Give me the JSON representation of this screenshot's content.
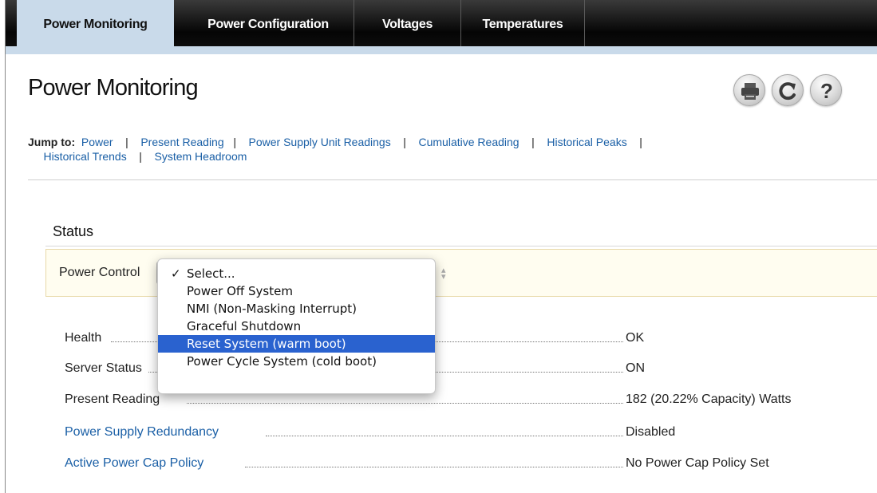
{
  "tabs": [
    {
      "label": "Power Monitoring",
      "active": true
    },
    {
      "label": "Power Configuration",
      "active": false
    },
    {
      "label": "Voltages",
      "active": false
    },
    {
      "label": "Temperatures",
      "active": false
    }
  ],
  "page": {
    "title": "Power Monitoring",
    "toolbar_icons": [
      "print-icon",
      "refresh-icon",
      "help-icon"
    ]
  },
  "jump": {
    "label": "Jump to:",
    "links": [
      "Power",
      "Present Reading",
      "Power Supply Unit Readings",
      "Cumulative Reading",
      "Historical Peaks",
      "Historical Trends",
      "System Headroom"
    ],
    "separator": "|"
  },
  "status": {
    "title": "Status",
    "power_control_label": "Power Control",
    "rows": [
      {
        "label": "Health",
        "value": "OK",
        "is_link": false
      },
      {
        "label": "Server Status",
        "value": "ON",
        "is_link": false
      },
      {
        "label": "Present Reading",
        "value": "182 (20.22% Capacity) Watts",
        "is_link": false
      },
      {
        "label": "Power Supply Redundancy",
        "value": "Disabled",
        "is_link": true
      },
      {
        "label": "Active Power Cap Policy",
        "value": "No Power Cap Policy Set",
        "is_link": true
      }
    ]
  },
  "menu": {
    "checkmark": "✓",
    "items": [
      {
        "label": "Select...",
        "checked": true,
        "highlighted": false
      },
      {
        "label": "Power Off System",
        "checked": false,
        "highlighted": false
      },
      {
        "label": "NMI (Non-Masking Interrupt)",
        "checked": false,
        "highlighted": false
      },
      {
        "label": "Graceful Shutdown",
        "checked": false,
        "highlighted": false
      },
      {
        "label": "Reset System (warm boot)",
        "checked": false,
        "highlighted": true
      },
      {
        "label": "Power Cycle System (cold boot)",
        "checked": false,
        "highlighted": false
      }
    ]
  },
  "colors": {
    "link": "#1a5fa6",
    "active_tab": "#c9daea",
    "menu_highlight": "#2a62cf"
  }
}
